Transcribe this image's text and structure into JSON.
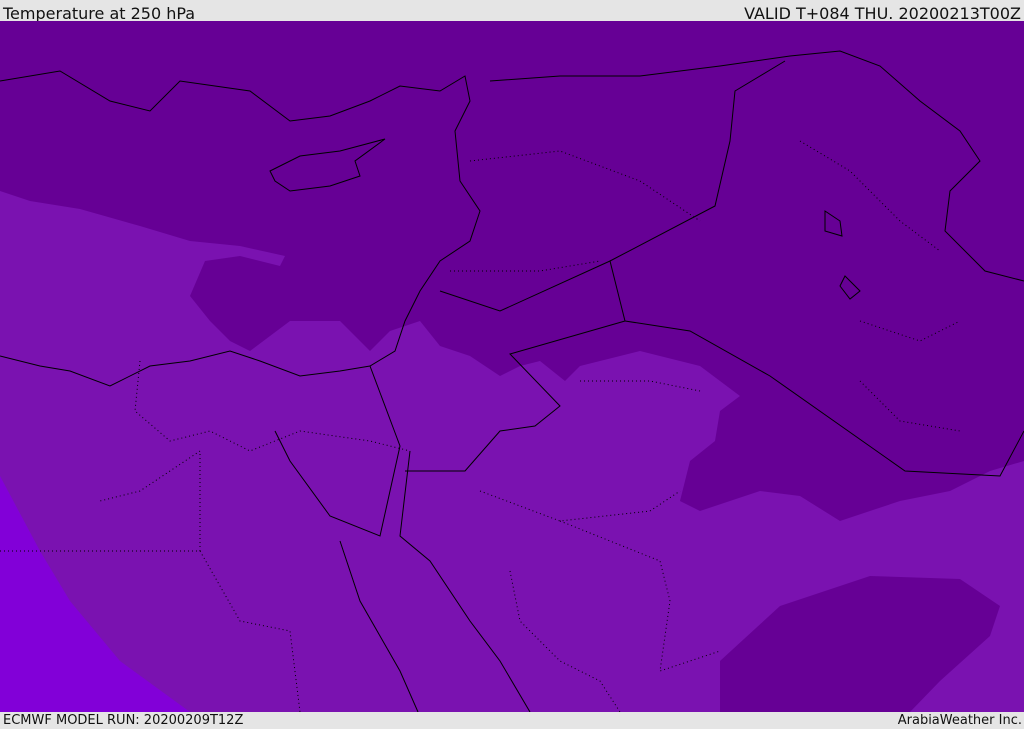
{
  "header": {
    "title": "Temperature at 250 hPa",
    "valid": "VALID T+084 THU. 20200213T00Z"
  },
  "footer": {
    "model_run": "ECMWF MODEL RUN: 20200209T12Z",
    "credit": "ArabiaWeather Inc."
  },
  "colors": {
    "cold": "#660095",
    "mid": "#7a12b0",
    "warm": "#8200d8",
    "coast": "#000000"
  }
}
